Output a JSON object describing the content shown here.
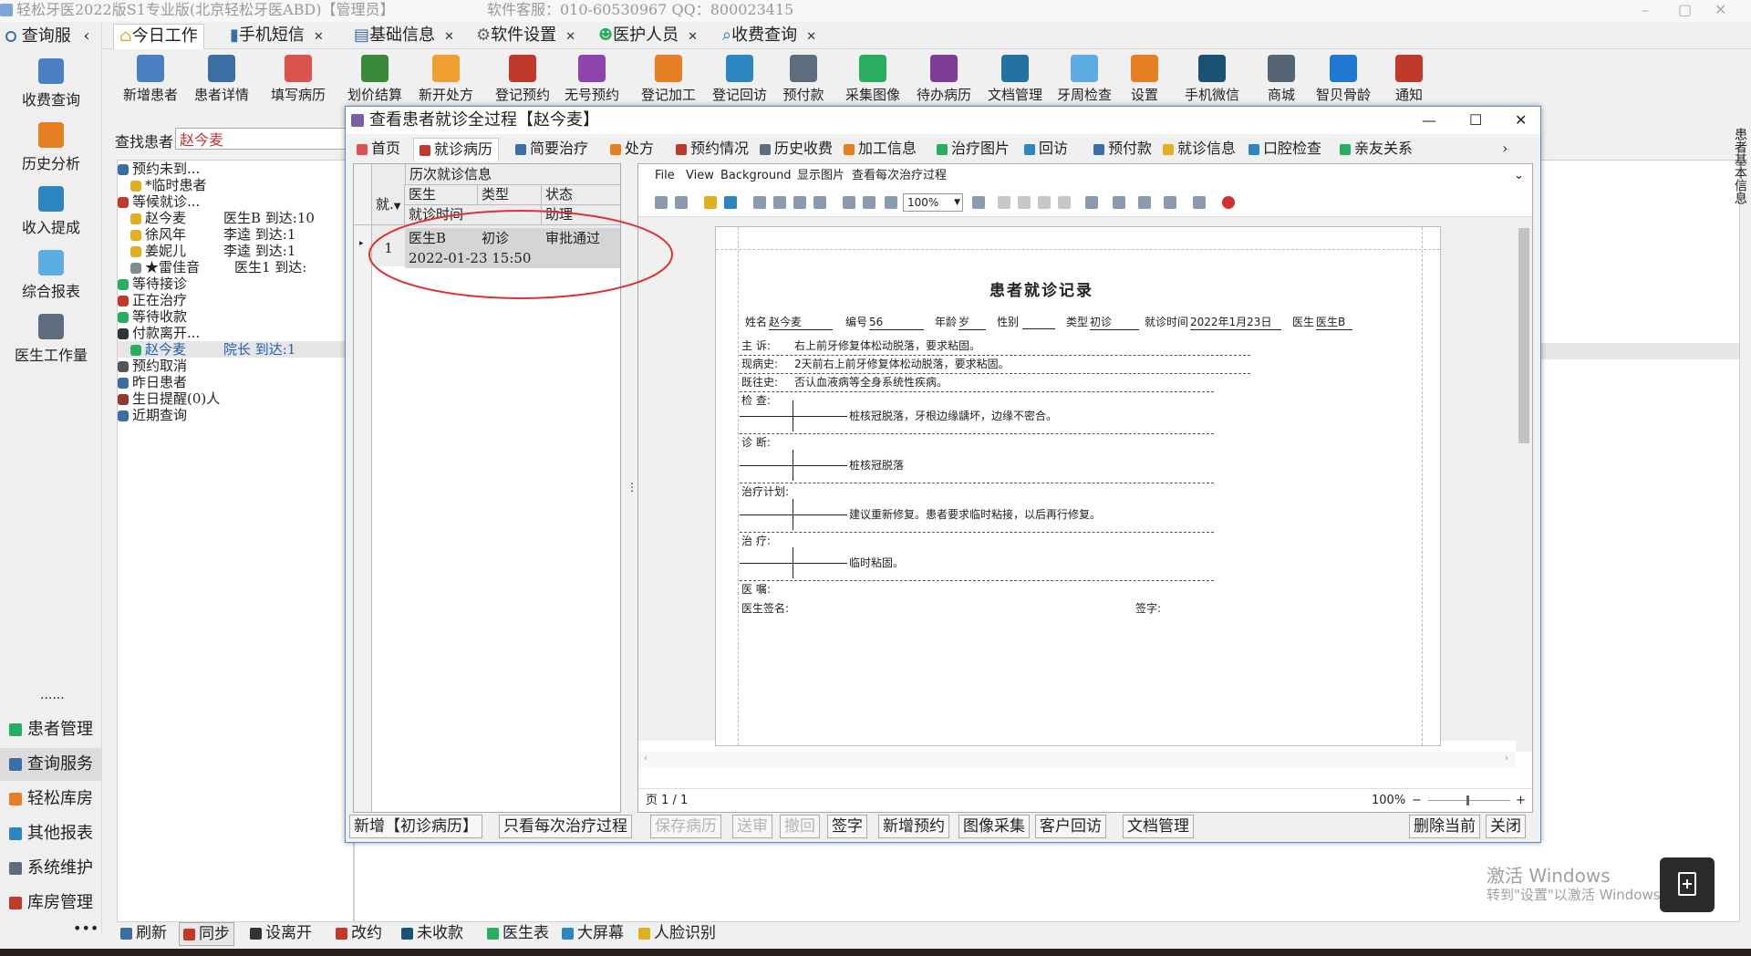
{
  "window": {
    "title": "轻松牙医2022版S1专业版(北京轻松牙医ABD)【管理员】",
    "hotline": "软件客服：010-60530967 QQ：800023415"
  },
  "left_header": {
    "title": "查询服"
  },
  "top_tabs": [
    {
      "label": "今日工作"
    },
    {
      "label": "手机短信"
    },
    {
      "label": "基础信息"
    },
    {
      "label": "软件设置"
    },
    {
      "label": "医护人员"
    },
    {
      "label": "收费查询"
    }
  ],
  "toolbar": [
    {
      "label": "新增患者",
      "color": "#4a7fc1"
    },
    {
      "label": "患者详情",
      "color": "#3a6ea5"
    },
    {
      "label": "填写病历",
      "color": "#d9534f"
    },
    {
      "label": "划价结算",
      "color": "#3b8a3b"
    },
    {
      "label": "新开处方",
      "color": "#f0a030"
    },
    {
      "label": "登记预约",
      "color": "#c0392b"
    },
    {
      "label": "无号预约",
      "color": "#8e44ad"
    },
    {
      "label": "登记加工",
      "color": "#e67e22"
    },
    {
      "label": "登记回访",
      "color": "#2e86c1"
    },
    {
      "label": "预付款",
      "color": "#5d6d7e"
    },
    {
      "label": "采集图像",
      "color": "#27ae60"
    },
    {
      "label": "待办病历",
      "color": "#7d3c98"
    },
    {
      "label": "文档管理",
      "color": "#2471a3"
    },
    {
      "label": "牙周检查",
      "color": "#5dade2"
    },
    {
      "label": "设置",
      "color": "#e67e22"
    },
    {
      "label": "手机微信",
      "color": "#1a5276"
    },
    {
      "label": "商城",
      "color": "#566573"
    },
    {
      "label": "智贝骨龄",
      "color": "#1f78d1"
    },
    {
      "label": "通知",
      "color": "#c0392b"
    }
  ],
  "left_nav": [
    {
      "label": "收费查询"
    },
    {
      "label": "历史分析"
    },
    {
      "label": "收入提成"
    },
    {
      "label": "综合报表"
    },
    {
      "label": "医生工作量"
    }
  ],
  "left_bottom": [
    {
      "label": "患者管理"
    },
    {
      "label": "查询服务"
    },
    {
      "label": "轻松库房"
    },
    {
      "label": "其他报表"
    },
    {
      "label": "系统维护"
    },
    {
      "label": "库房管理"
    }
  ],
  "search": {
    "label": "查找患者",
    "value": "赵今麦"
  },
  "tree": [
    {
      "text": "预约未到...",
      "color": "#3a6ea5"
    },
    {
      "text": "*临时患者",
      "color": "#e0b020"
    },
    {
      "text": "等候就诊...",
      "color": "#c0392b"
    },
    {
      "text": "赵今麦",
      "extra": "医生B  到达:10",
      "color": "#e0b020"
    },
    {
      "text": "徐风年",
      "extra": "李逵    到达:1",
      "color": "#e0b020"
    },
    {
      "text": "姜妮儿",
      "extra": "李逵    到达:1",
      "color": "#e0b020"
    },
    {
      "text": "★雷佳音",
      "extra": "医生1 到达:",
      "color": "#7f8c8d"
    },
    {
      "text": "等待接诊",
      "color": "#27ae60"
    },
    {
      "text": "正在治疗",
      "color": "#c0392b"
    },
    {
      "text": "等待收款",
      "color": "#27ae60"
    },
    {
      "text": "付款离开...",
      "color": "#333333"
    },
    {
      "text": "赵今麦",
      "extra": "院长    到达:1",
      "color": "#27ae60"
    },
    {
      "text": "预约取消",
      "color": "#555555"
    },
    {
      "text": "昨日患者",
      "color": "#3a6ea5"
    },
    {
      "text": "生日提醒(0)人",
      "color": "#8e3b2b"
    },
    {
      "text": "近期查询",
      "color": "#3a6ea5"
    }
  ],
  "bottom_bar": [
    {
      "label": "刷新"
    },
    {
      "label": "同步"
    },
    {
      "label": "设离开"
    },
    {
      "label": "改约"
    },
    {
      "label": "未收款"
    },
    {
      "label": "医生表"
    },
    {
      "label": "大屏幕"
    },
    {
      "label": "人脸识别"
    }
  ],
  "dialog": {
    "title": "查看患者就诊全过程【赵今麦】",
    "tabs": [
      {
        "label": "首页"
      },
      {
        "label": "就诊病历"
      },
      {
        "label": "简要治疗"
      },
      {
        "label": "处方"
      },
      {
        "label": "预约情况"
      },
      {
        "label": "历史收费"
      },
      {
        "label": "加工信息"
      },
      {
        "label": "治疗图片"
      },
      {
        "label": "回访"
      },
      {
        "label": "预付款"
      },
      {
        "label": "就诊信息"
      },
      {
        "label": "口腔检查"
      },
      {
        "label": "亲友关系"
      }
    ],
    "grid": {
      "band_title": "历次就诊信息",
      "col_index": "就.",
      "col_doctor": "医生",
      "col_type": "类型",
      "col_status": "状态",
      "col_time": "就诊时间",
      "col_assistant": "助理",
      "rows": [
        {
          "index": "1",
          "doctor": "医生B",
          "type": "初诊",
          "status": "审批通过",
          "time": "2022-01-23 15:50"
        }
      ]
    },
    "viewer": {
      "menu": [
        "File",
        "View",
        "Background",
        "显示图片",
        "查看每次治疗过程"
      ],
      "zoom": "100%",
      "page_status": "页 1 / 1",
      "zoom_status": "100%"
    },
    "record": {
      "title": "患者就诊记录",
      "name_label": "姓名",
      "name": "赵今麦",
      "id_label": "编号",
      "id": "56",
      "age_label": "年龄",
      "age_unit": "岁",
      "sex_label": "性别",
      "type_label": "类型",
      "type": "初诊",
      "date_label": "就诊时间",
      "date": "2022年1月23日",
      "doctor_label": "医生",
      "doctor": "医生B",
      "complaint_label": "主  诉:",
      "complaint": "右上前牙修复体松动脱落，要求粘固。",
      "history_label": "现病史:",
      "history": "2天前右上前牙修复体松动脱落，要求粘固。",
      "past_label": "既往史:",
      "past": "否认血液病等全身系统性疾病。",
      "exam_label": "检  查:",
      "exam": "桩核冠脱落，牙根边缘龋坏，边缘不密合。",
      "diag_label": "诊  断:",
      "diag": "桩核冠脱落",
      "plan_label": "治疗计划:",
      "plan": "建议重新修复。患者要求临时粘接，以后再行修复。",
      "treat_label": "治  疗:",
      "treat": "临时粘固。",
      "advice_label": "医  嘱:",
      "sign_label": "医生签名:",
      "sign2_label": "签字:"
    },
    "buttons": [
      {
        "label": "新增【初诊病历】",
        "disabled": false
      },
      {
        "label": "只看每次治疗过程",
        "disabled": false
      },
      {
        "label": "保存病历",
        "disabled": true
      },
      {
        "label": "送审",
        "disabled": true
      },
      {
        "label": "撤回",
        "disabled": true
      },
      {
        "label": "签字",
        "disabled": false
      },
      {
        "label": "新增预约",
        "disabled": false
      },
      {
        "label": "图像采集",
        "disabled": false
      },
      {
        "label": "客户回访",
        "disabled": false
      },
      {
        "label": "文档管理",
        "disabled": false
      },
      {
        "label": "删除当前",
        "disabled": false
      },
      {
        "label": "关闭",
        "disabled": false
      }
    ]
  },
  "right_sidebar": {
    "label": "患者基本信息"
  },
  "watermark": {
    "line1": "激活 Windows",
    "line2": "转到\"设置\"以激活 Windows。"
  },
  "colors": {
    "accent": "#5b8bd0",
    "highlight_circle": "#e03030"
  }
}
